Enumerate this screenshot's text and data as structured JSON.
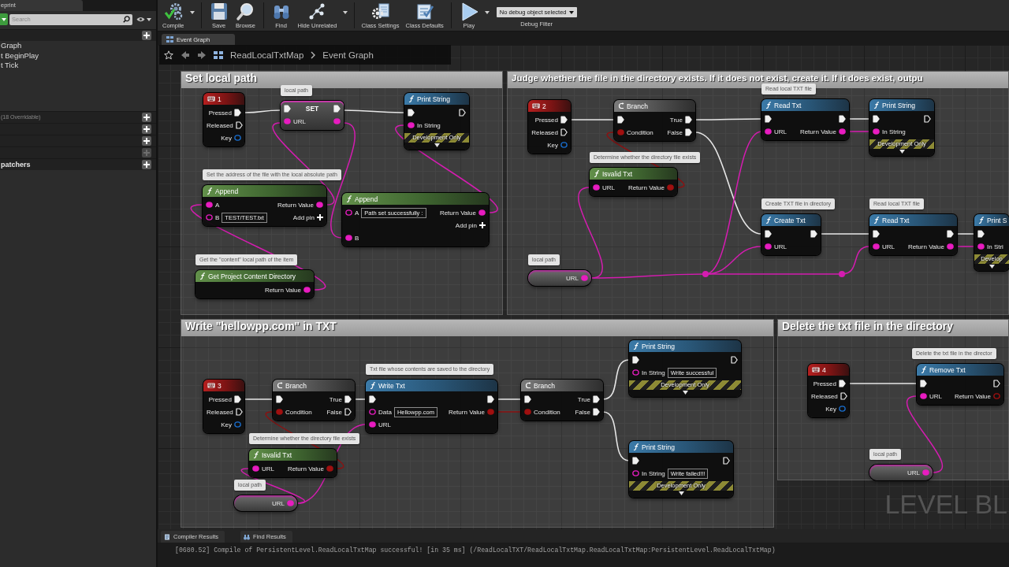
{
  "my_blueprint": {
    "tab": "eprint",
    "search": {
      "placeholder": "Search"
    },
    "sections": [
      {
        "add_disabled": false,
        "items": [
          "Graph",
          "t BeginPlay",
          "t Tick"
        ]
      },
      {
        "note": "(18 Overridable)",
        "add_disabled": false
      },
      {
        "add_disabled": false
      },
      {
        "add_disabled": false
      },
      {
        "add_disabled": true
      },
      {
        "label": "patchers",
        "add_disabled": false
      }
    ]
  },
  "toolbar": {
    "groups": [
      {
        "buttons": [
          {
            "kind": "compile",
            "label": "Compile",
            "menu": true
          }
        ]
      },
      {
        "buttons": [
          {
            "kind": "save",
            "label": "Save",
            "menu": false
          },
          {
            "kind": "browse",
            "label": "Browse",
            "menu": false
          }
        ]
      },
      {
        "buttons": [
          {
            "kind": "find",
            "label": "Find",
            "menu": false
          },
          {
            "kind": "hide_unrelated",
            "label": "Hide Unrelated",
            "menu": true
          }
        ]
      },
      {
        "buttons": [
          {
            "kind": "class_settings",
            "label": "Class Settings",
            "menu": false
          },
          {
            "kind": "class_defaults",
            "label": "Class Defaults",
            "menu": false
          }
        ]
      },
      {
        "buttons": [
          {
            "kind": "play",
            "label": "Play",
            "menu": true
          }
        ]
      }
    ],
    "debug_filter": {
      "value": "No debug object selected",
      "label": "Debug Filter"
    }
  },
  "editor_tabs": [
    {
      "label": "Event Graph"
    }
  ],
  "breadcrumb": [
    "ReadLocalTxtMap",
    "Event Graph"
  ],
  "comments": [
    {
      "title": "Set local path"
    },
    {
      "title": "Judge whether the file in the directory exists. If it does not exist, create it. If it does exist, outpu"
    },
    {
      "title": "Write \"hellowpp.com\" in TXT"
    },
    {
      "title": "Delete the txt file in the directory"
    }
  ],
  "nodes": [
    {
      "kind": "key_event",
      "title": "1",
      "rows": [
        {
          "right": {
            "kind": "exec",
            "label": "Pressed",
            "connected": true
          }
        },
        {
          "right": {
            "kind": "exec",
            "label": "Released",
            "connected": false
          }
        },
        {
          "right": {
            "kind": "key",
            "label": "Key",
            "connected": false
          }
        }
      ]
    },
    {
      "kind": "set",
      "title": "SET",
      "comment": "local path",
      "rows": [
        {
          "left": {
            "kind": "exec",
            "connected": true
          },
          "right": {
            "kind": "exec",
            "connected": true
          }
        },
        {
          "left": {
            "kind": "string",
            "label": "URL",
            "connected": true
          },
          "right": {
            "kind": "string",
            "connected": true
          }
        }
      ]
    },
    {
      "kind": "function",
      "title": "Print String",
      "rows": [
        {
          "left": {
            "kind": "exec",
            "connected": true
          },
          "right": {
            "kind": "exec",
            "connected": false
          }
        },
        {
          "left": {
            "kind": "string",
            "label": "In String",
            "connected": true
          }
        }
      ],
      "footer": "Development Only"
    },
    {
      "kind": "pure",
      "title": "Append",
      "comment": "Set the address of the file with the local absolute path",
      "rows": [
        {
          "left": {
            "kind": "string",
            "label": "A",
            "connected": true
          },
          "right": {
            "kind": "string",
            "label": "Return Value",
            "connected": true
          }
        },
        {
          "left": {
            "kind": "string",
            "label": "B",
            "connected": false,
            "value": "TEST/TEST.txt"
          },
          "right": {
            "kind": "add",
            "label": "Add pin"
          }
        }
      ]
    },
    {
      "kind": "pure",
      "title": "Append",
      "rows": [
        {
          "left": {
            "kind": "string",
            "label": "A",
            "connected": false,
            "value": "Path set successfully :"
          },
          "right": {
            "kind": "string",
            "label": "Return Value",
            "connected": true
          }
        },
        {
          "right": {
            "kind": "add",
            "label": "Add pin"
          }
        },
        {
          "left": {
            "kind": "string",
            "label": "B",
            "connected": true
          }
        }
      ]
    },
    {
      "kind": "pure",
      "title": "Get Project Content Directory",
      "comment": "Get the \"content\" local path of the item",
      "rows": [
        {
          "right": {
            "kind": "string",
            "label": "Return Value",
            "connected": true
          }
        }
      ]
    },
    {
      "kind": "key_event",
      "title": "2",
      "rows": [
        {
          "right": {
            "kind": "exec",
            "label": "Pressed",
            "connected": true
          }
        },
        {
          "right": {
            "kind": "exec",
            "label": "Released",
            "connected": false
          }
        },
        {
          "right": {
            "kind": "key",
            "label": "Key",
            "connected": false
          }
        }
      ]
    },
    {
      "kind": "branch",
      "title": "Branch",
      "rows": [
        {
          "left": {
            "kind": "exec",
            "connected": true
          },
          "right": {
            "kind": "exec",
            "label": "True",
            "connected": true
          }
        },
        {
          "left": {
            "kind": "bool",
            "label": "Condition",
            "connected": true
          },
          "right": {
            "kind": "exec",
            "label": "False",
            "connected": true
          }
        }
      ]
    },
    {
      "kind": "function",
      "title": "Read Txt",
      "comment": "Read local TXT file",
      "rows": [
        {
          "left": {
            "kind": "exec",
            "connected": true
          },
          "right": {
            "kind": "exec",
            "connected": true
          }
        },
        {
          "left": {
            "kind": "string",
            "label": "URL",
            "connected": true
          },
          "right": {
            "kind": "string",
            "label": "Return Value",
            "connected": true
          }
        }
      ]
    },
    {
      "kind": "function",
      "title": "Print String",
      "rows": [
        {
          "left": {
            "kind": "exec",
            "connected": true
          },
          "right": {
            "kind": "exec",
            "connected": false
          }
        },
        {
          "left": {
            "kind": "string",
            "label": "In String",
            "connected": true
          }
        }
      ],
      "footer": "Development Only"
    },
    {
      "kind": "pure",
      "title": "Isvalid Txt",
      "comment": "Determine whether the directory file exists",
      "rows": [
        {
          "left": {
            "kind": "string",
            "label": "URL",
            "connected": true
          },
          "right": {
            "kind": "bool",
            "label": "Return Value",
            "connected": true
          }
        }
      ]
    },
    {
      "kind": "function",
      "title": "Create Txt",
      "comment": "Create TXT file in directory",
      "rows": [
        {
          "left": {
            "kind": "exec",
            "connected": true
          },
          "right": {
            "kind": "exec",
            "connected": true
          }
        },
        {
          "left": {
            "kind": "string",
            "label": "URL",
            "connected": true
          }
        }
      ]
    },
    {
      "kind": "function",
      "title": "Read Txt",
      "comment": "Read local TXT file",
      "rows": [
        {
          "left": {
            "kind": "exec",
            "connected": true
          },
          "right": {
            "kind": "exec",
            "connected": true
          }
        },
        {
          "left": {
            "kind": "string",
            "label": "URL",
            "connected": true
          },
          "right": {
            "kind": "string",
            "label": "Return Value",
            "connected": true
          }
        }
      ]
    },
    {
      "kind": "function",
      "title": "Print S",
      "rows": [
        {
          "left": {
            "kind": "exec",
            "connected": true
          }
        },
        {
          "left": {
            "kind": "string",
            "label": "In Stri",
            "connected": true
          }
        }
      ],
      "footer": "Develop"
    },
    {
      "kind": "getter",
      "comment": "local path",
      "rows": [
        {
          "right": {
            "kind": "string",
            "label": "URL",
            "connected": true
          }
        }
      ]
    },
    {
      "kind": "key_event",
      "title": "3",
      "rows": [
        {
          "right": {
            "kind": "exec",
            "label": "Pressed",
            "connected": true
          }
        },
        {
          "right": {
            "kind": "exec",
            "label": "Released",
            "connected": false
          }
        },
        {
          "right": {
            "kind": "key",
            "label": "Key",
            "connected": false
          }
        }
      ]
    },
    {
      "kind": "branch",
      "title": "Branch",
      "rows": [
        {
          "left": {
            "kind": "exec",
            "connected": true
          },
          "right": {
            "kind": "exec",
            "label": "True",
            "connected": true
          }
        },
        {
          "left": {
            "kind": "bool",
            "label": "Condition",
            "connected": true
          },
          "right": {
            "kind": "exec",
            "label": "False",
            "connected": false
          }
        }
      ]
    },
    {
      "kind": "function",
      "title": "Write Txt",
      "comment": "Txt file whose contents are saved to the directory",
      "rows": [
        {
          "left": {
            "kind": "exec",
            "connected": true
          },
          "right": {
            "kind": "exec",
            "connected": true
          }
        },
        {
          "left": {
            "kind": "string",
            "label": "Data",
            "connected": false,
            "value": "Hellowpp.com"
          },
          "right": {
            "kind": "bool",
            "label": "Return Value",
            "connected": true
          }
        },
        {
          "left": {
            "kind": "string",
            "label": "URL",
            "connected": true
          }
        }
      ]
    },
    {
      "kind": "branch",
      "title": "Branch",
      "rows": [
        {
          "left": {
            "kind": "exec",
            "connected": true
          },
          "right": {
            "kind": "exec",
            "label": "True",
            "connected": true
          }
        },
        {
          "left": {
            "kind": "bool",
            "label": "Condition",
            "connected": true
          },
          "right": {
            "kind": "exec",
            "label": "False",
            "connected": true
          }
        }
      ]
    },
    {
      "kind": "function",
      "title": "Print String",
      "rows": [
        {
          "left": {
            "kind": "exec",
            "connected": true
          },
          "right": {
            "kind": "exec",
            "connected": false
          }
        },
        {
          "left": {
            "kind": "string",
            "label": "In String",
            "connected": false,
            "value": "Write successful"
          }
        }
      ],
      "footer": "Development Only"
    },
    {
      "kind": "pure",
      "title": "Isvalid Txt",
      "comment": "Determine whether the directory file exists",
      "rows": [
        {
          "left": {
            "kind": "string",
            "label": "URL",
            "connected": true
          },
          "right": {
            "kind": "bool",
            "label": "Return Value",
            "connected": true
          }
        }
      ]
    },
    {
      "kind": "getter",
      "comment": "local path",
      "rows": [
        {
          "right": {
            "kind": "string",
            "label": "URL",
            "connected": true
          }
        }
      ]
    },
    {
      "kind": "function",
      "title": "Print String",
      "rows": [
        {
          "left": {
            "kind": "exec",
            "connected": true
          },
          "right": {
            "kind": "exec",
            "connected": false
          }
        },
        {
          "left": {
            "kind": "string",
            "label": "In String",
            "connected": false,
            "value": "Write failed!!!"
          }
        }
      ],
      "footer": "Development Only"
    },
    {
      "kind": "key_event",
      "title": "4",
      "rows": [
        {
          "right": {
            "kind": "exec",
            "label": "Pressed",
            "connected": true
          }
        },
        {
          "right": {
            "kind": "exec",
            "label": "Released",
            "connected": false
          }
        },
        {
          "right": {
            "kind": "key",
            "label": "Key",
            "connected": false
          }
        }
      ]
    },
    {
      "kind": "function",
      "title": "Remove Txt",
      "comment": "Delete the txt file in the director",
      "rows": [
        {
          "left": {
            "kind": "exec",
            "connected": true
          },
          "right": {
            "kind": "exec",
            "connected": false
          }
        },
        {
          "left": {
            "kind": "string",
            "label": "URL",
            "connected": true
          },
          "right": {
            "kind": "bool",
            "label": "Return Value",
            "connected": false
          }
        }
      ]
    },
    {
      "kind": "getter",
      "comment": "local path",
      "rows": [
        {
          "right": {
            "kind": "string",
            "label": "URL",
            "connected": true
          }
        }
      ]
    }
  ],
  "graph_corner_label": "LEVEL BL",
  "bottom_tabs": [
    {
      "kind": "compiler",
      "label": "Compiler Results"
    },
    {
      "kind": "find",
      "label": "Find Results"
    }
  ],
  "log": [
    "[0680.52] Compile of PersistentLevel.ReadLocalTxtMap successful! [in 35 ms] (/ReadLocalTXT/ReadLocalTxtMap.ReadLocalTxtMap:PersistentLevel.ReadLocalTxtMap)"
  ]
}
